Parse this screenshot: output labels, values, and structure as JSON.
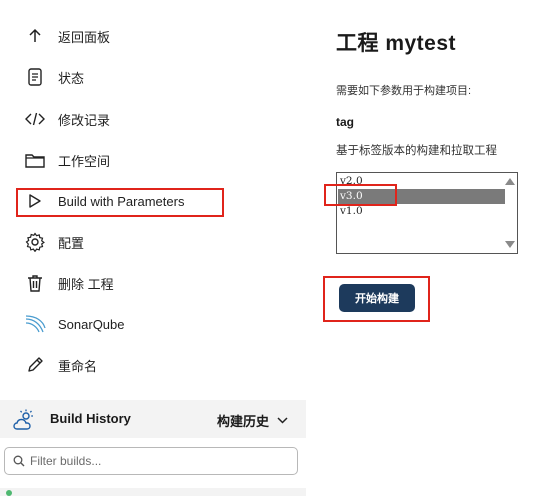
{
  "sidebar": {
    "items": [
      {
        "label": "返回面板",
        "icon": "arrow-up-icon"
      },
      {
        "label": "状态",
        "icon": "document-icon"
      },
      {
        "label": "修改记录",
        "icon": "code-icon"
      },
      {
        "label": "工作空间",
        "icon": "folder-icon"
      },
      {
        "label": "Build with Parameters",
        "icon": "play-icon"
      },
      {
        "label": "配置",
        "icon": "gear-icon"
      },
      {
        "label": "删除 工程",
        "icon": "trash-icon"
      },
      {
        "label": "SonarQube",
        "icon": "sonarqube-icon"
      },
      {
        "label": "重命名",
        "icon": "pencil-icon"
      }
    ]
  },
  "build_history": {
    "title": "Build History",
    "right_label": "构建历史",
    "filter_placeholder": "Filter builds..."
  },
  "main": {
    "title": "工程 mytest",
    "description": "需要如下参数用于构建项目:",
    "parameter": {
      "name": "tag",
      "description": "基于标签版本的构建和拉取工程",
      "options": [
        "v2.0",
        "v3.0",
        "v1.0"
      ],
      "selected": "v3.0"
    },
    "build_button": "开始构建"
  },
  "colors": {
    "annotation": "#e0241b",
    "button_bg": "#1d3a5c",
    "selected_option_bg": "#7a7a7a",
    "history_bar_bg": "#f3f3f3"
  }
}
